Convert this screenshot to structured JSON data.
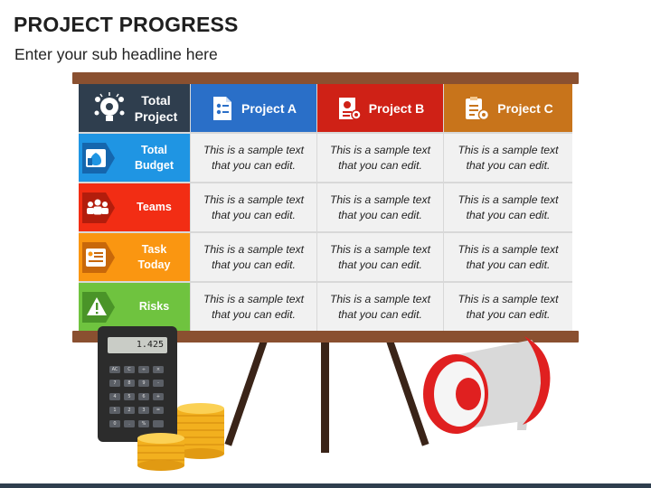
{
  "page": {
    "title": "PROJECT PROGRESS",
    "subtitle": "Enter your sub headline here"
  },
  "table": {
    "corner": {
      "line1": "Total",
      "line2": "Project",
      "icon": "lightbulb-gears-icon",
      "color": "#2f3e4e"
    },
    "columns": [
      {
        "label": "Project A",
        "icon": "document-icon",
        "color": "#2a6fc8"
      },
      {
        "label": "Project B",
        "icon": "certificate-icon",
        "color": "#cf2116"
      },
      {
        "label": "Project C",
        "icon": "clipboard-gear-icon",
        "color": "#c8741b"
      }
    ],
    "rows": [
      {
        "line1": "Total",
        "line2": "Budget",
        "icon": "money-bag-icon",
        "color": "#1f95e3",
        "cells": [
          "This is a sample text that you can edit.",
          "This is a sample text that you can edit.",
          "This is a sample text that you can edit."
        ]
      },
      {
        "line1": "Teams",
        "line2": "",
        "icon": "team-icon",
        "color": "#f22d14",
        "cells": [
          "This is a sample text that you can edit.",
          "This is a sample text that you can edit.",
          "This is a sample text that you can edit."
        ]
      },
      {
        "line1": "Task",
        "line2": "Today",
        "icon": "task-board-icon",
        "color": "#fa9611",
        "cells": [
          "This is a sample text that you can edit.",
          "This is a sample text that you can edit.",
          "This is a sample text that you can edit."
        ]
      },
      {
        "line1": "Risks",
        "line2": "",
        "icon": "warning-icon",
        "color": "#6fc33f",
        "cells": [
          "This is a sample text that you can edit.",
          "This is a sample text that you can edit.",
          "This is a sample text that you can edit."
        ]
      }
    ]
  },
  "calculator": {
    "display": "1.425",
    "keys": [
      "AC",
      "C",
      "÷",
      "×",
      "7",
      "8",
      "9",
      "-",
      "4",
      "5",
      "6",
      "+",
      "1",
      "2",
      "3",
      "=",
      "0",
      ".",
      "%",
      ""
    ]
  }
}
